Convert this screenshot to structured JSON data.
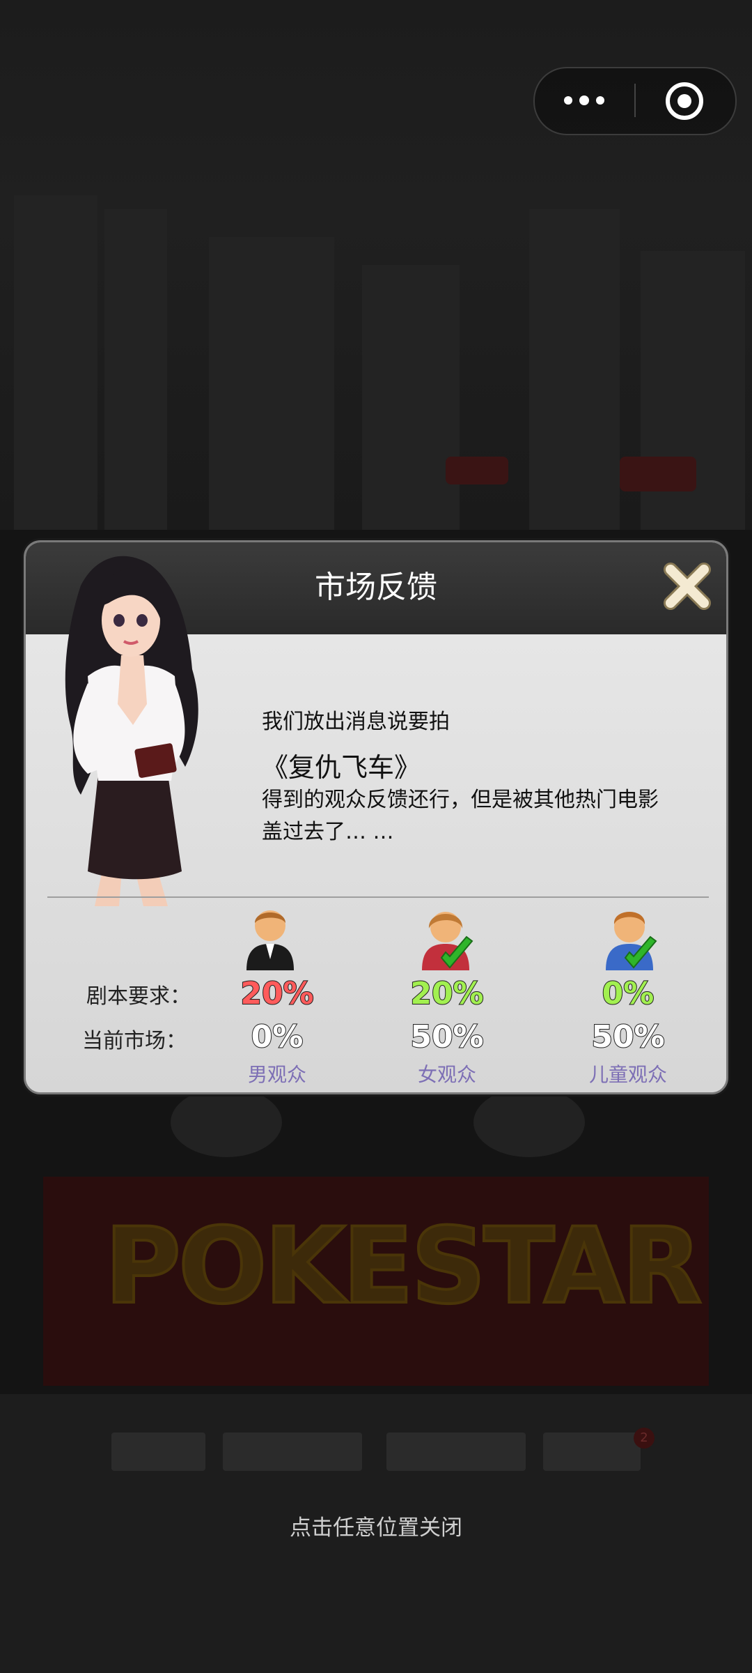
{
  "capsule": {
    "more_icon": "more-dots-icon",
    "close_icon": "target-circle-icon"
  },
  "dialog": {
    "title": "市场反馈",
    "close_icon": "close-x-icon",
    "message": {
      "line1": "我们放出消息说要拍",
      "movie_title": "《复仇飞车》",
      "line2": "得到的观众反馈还行，但是被其他热门电影",
      "line3": "盖过去了…  …"
    },
    "rows": {
      "requirement_label": "剧本要求：",
      "market_label": "当前市场："
    },
    "audiences": [
      {
        "name": "男观众",
        "requirement": "20%",
        "market": "0%",
        "checked": false,
        "color": "#ff5b5b"
      },
      {
        "name": "女观众",
        "requirement": "20%",
        "market": "50%",
        "checked": true,
        "color": "#a2f050"
      },
      {
        "name": "儿童观众",
        "requirement": "0%",
        "market": "50%",
        "checked": true,
        "color": "#a2f050"
      }
    ]
  },
  "background": {
    "sign_text": "POKESTAR",
    "badge": "2"
  },
  "hint": "点击任意位置关闭"
}
